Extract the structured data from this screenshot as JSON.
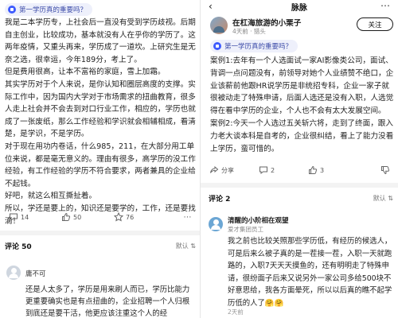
{
  "left": {
    "topic_tag": "第一学历真的重要吗？",
    "body": [
      "我是二本学历专，上社会后一直没有受到学历歧视。后期自主创业，比较成功，基本就没有人在乎你的学历了。这两年疫情，又重头再来，学历成了一道坎。上研究生是无奈之选，很幸运，今年189分，考上了。",
      "但是费用很高，让本不富裕的家庭，雪上加霜。",
      "其实学历对于个人来说，是你认知和圈层高度的支撑。实际工作中，因为国内大学对于市场需求的扭曲教育，很多人走上社会并不会去到对口行业工作，相应的，学历也就成了一张废纸，那么工作经验和学识就会相辅相成，看清楚，是学识，不是学历。",
      "对于现在用功内卷话，什么985，211，在大部分用工单位来说，都是毫无意义的。理由有很多，高学历的没工作经验，有工作经验的学历不符合要求，两者兼具的企业给不起钱。",
      "好吧，就这么相互撕扯着。",
      "所以，学还是要上的，知识还是要学的，工作，还是要找滴！"
    ],
    "actions": {
      "comments": "14",
      "likes": "50",
      "favorites": "76"
    },
    "comment_count_label": "评论 50",
    "sort_label": "默认",
    "comment": {
      "author": "庸不可",
      "text": "还是人太多了，学历是用来刷人而已，学历比能力更重要确实也是有点扭曲的，企业招聘一个人归根到底还是要干活，他更应该注重这个人的经"
    }
  },
  "right": {
    "header_title": "脉脉",
    "author": {
      "name": "在杠海旅游的小栗子",
      "meta": "4天前 · 猎头"
    },
    "follow_label": "关注",
    "topic_tag": "第一学历真的重要吗？",
    "body": [
      "案例1:去年有一个人选面试一家AI影像类公司，面试、背调一点问题没有，前领导对她个人业绩赞不绝口，企业该薪前他跟HR说学历是非统招专科，企业一家子就很被动走了特殊申请，后面人选还是没有入职，人选觉得在看中学历的企业，个人也不会有太大发展空间。",
      "案例2:今天一个人选过五关斩六将，走到了终面，跟入力老大谈本科是自考的，企业很纠结，看上了能力没看上学历，蛮可惜的。"
    ],
    "actions": {
      "share": "分享",
      "comments": "2",
      "likes": "3",
      "dislike": ""
    },
    "comment_count_label": "评论 2",
    "sort_label": "默认",
    "comment": {
      "author": "清醒的小阶相在观望",
      "company": "爱才集团员工",
      "text": "我之前也比较关照那些学历低，有经历的候选人，可是后来么被子真的是一茬接一茬，入职一天就跑路的，入职7天天天摸鱼的，还有明明走了特殊申请，很纷面子后来又说另外一家公司多给500块不好意思给，我各方面晕死，所以以后真的瞧不起学历低的人了🤗🤗",
      "time": "2天前"
    }
  }
}
